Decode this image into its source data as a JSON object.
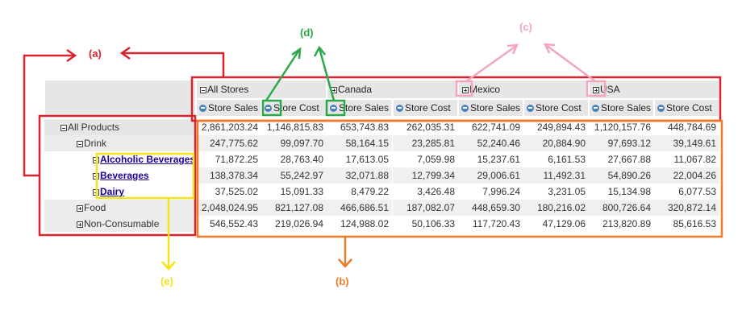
{
  "annotations": {
    "a": "(a)",
    "b": "(b)",
    "c": "(c)",
    "d": "(d)",
    "e": "(e)",
    "colors": {
      "a": "#d9232e",
      "b": "#f07a26",
      "c": "#f4a6c0",
      "d": "#2aa84a",
      "e": "#f2e31a"
    }
  },
  "columns": {
    "groups": [
      "All Stores",
      "Canada",
      "Mexico",
      "USA"
    ],
    "measures": [
      "Store Sales",
      "Store Cost"
    ]
  },
  "rows": [
    {
      "label": "All Products",
      "level": 0,
      "toggle": "minus",
      "link": false,
      "values": [
        "2,861,203.24",
        "1,146,815.83",
        "653,743.83",
        "262,035.31",
        "622,741.09",
        "249,894.43",
        "1,120,157.76",
        "448,784.69"
      ]
    },
    {
      "label": "Drink",
      "level": 1,
      "toggle": "minus",
      "link": false,
      "values": [
        "247,775.62",
        "99,097.70",
        "58,164.15",
        "23,285.81",
        "52,240.46",
        "20,884.90",
        "97,693.12",
        "39,149.61"
      ]
    },
    {
      "label": "Alcoholic Beverages",
      "level": 2,
      "toggle": "plus",
      "link": true,
      "values": [
        "71,872.25",
        "28,763.40",
        "17,613.05",
        "7,059.98",
        "15,237.61",
        "6,161.53",
        "27,667.88",
        "11,067.82"
      ]
    },
    {
      "label": "Beverages",
      "level": 2,
      "toggle": "plus",
      "link": true,
      "values": [
        "138,378.34",
        "55,242.97",
        "32,071.88",
        "12,799.34",
        "29,006.61",
        "11,492.31",
        "54,890.26",
        "22,004.26"
      ]
    },
    {
      "label": "Dairy",
      "level": 2,
      "toggle": "plus",
      "link": true,
      "values": [
        "37,525.02",
        "15,091.33",
        "8,479.22",
        "3,426.48",
        "7,996.24",
        "3,231.05",
        "15,134.98",
        "6,077.53"
      ]
    },
    {
      "label": "Food",
      "level": 1,
      "toggle": "plus",
      "link": false,
      "values": [
        "2,048,024.95",
        "821,127.08",
        "466,686.51",
        "187,082.07",
        "448,659.30",
        "180,216.02",
        "800,726.64",
        "320,872.14"
      ]
    },
    {
      "label": "Non-Consumable",
      "level": 1,
      "toggle": "plus",
      "link": false,
      "values": [
        "546,552.43",
        "219,026.94",
        "124,988.02",
        "50,106.33",
        "117,720.43",
        "47,129.06",
        "213,820.89",
        "85,616.53"
      ]
    }
  ]
}
